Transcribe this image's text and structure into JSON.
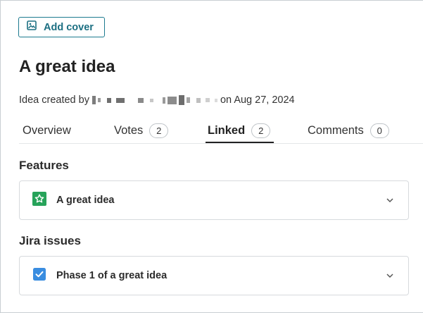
{
  "toolbar": {
    "add_cover_label": "Add cover"
  },
  "idea": {
    "title": "A great idea",
    "created_prefix": "Idea created by",
    "created_suffix": "on Aug 27, 2024"
  },
  "tabs": [
    {
      "label": "Overview"
    },
    {
      "label": "Votes",
      "count": "2"
    },
    {
      "label": "Linked",
      "count": "2"
    },
    {
      "label": "Comments",
      "count": "0"
    }
  ],
  "sections": {
    "features": {
      "heading": "Features",
      "item": {
        "title": "A great idea",
        "icon": "star-icon",
        "color": "#27a35a"
      }
    },
    "jira": {
      "heading": "Jira issues",
      "item": {
        "title": "Phase 1 of a great idea",
        "icon": "checkbox-icon",
        "color": "#3a8de0"
      }
    }
  }
}
